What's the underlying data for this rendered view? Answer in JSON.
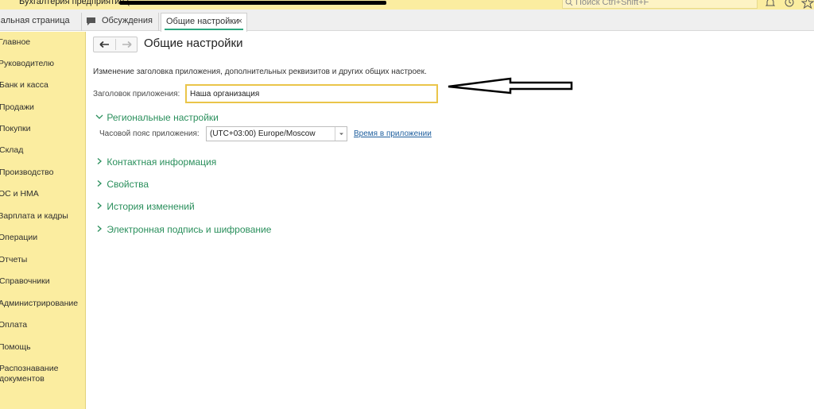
{
  "titlebar": {
    "app_title": "Бухгалтерия предприятия (",
    "search_placeholder": "Поиск Ctrl+Shift+F"
  },
  "tabs": [
    {
      "label": "чальная страница"
    },
    {
      "label": "Обсуждения"
    },
    {
      "label": "Общие настройки",
      "close": "×"
    }
  ],
  "sidebar": {
    "items": [
      {
        "label": "Главное"
      },
      {
        "label": "Руководителю"
      },
      {
        "label": "Банк и касса"
      },
      {
        "label": "Продажи"
      },
      {
        "label": "Покупки"
      },
      {
        "label": "Склад"
      },
      {
        "label": "Производство"
      },
      {
        "label": "ОС и НМА"
      },
      {
        "label": "Зарплата и кадры"
      },
      {
        "label": "Операции"
      },
      {
        "label": "Отчеты"
      },
      {
        "label": "Справочники"
      },
      {
        "label": "Администрирование"
      },
      {
        "label": "Оплата"
      },
      {
        "label": "Помощь"
      },
      {
        "label": "Распознавание документов"
      }
    ]
  },
  "main": {
    "title": "Общие настройки",
    "description": "Изменение заголовка приложения, дополнительных реквизитов и других общих настроек.",
    "app_title_label": "Заголовок приложения:",
    "app_title_value": "Наша организация",
    "sections": [
      {
        "label": "Региональные настройки",
        "expanded": true
      },
      {
        "label": "Контактная информация",
        "expanded": false
      },
      {
        "label": "Свойства",
        "expanded": false
      },
      {
        "label": "История изменений",
        "expanded": false
      },
      {
        "label": "Электронная подпись и шифрование",
        "expanded": false
      }
    ],
    "timezone_label": "Часовой пояс приложения:",
    "timezone_value": "(UTC+03:00) Europe/Moscow",
    "timezone_link": "Время в приложении"
  },
  "colors": {
    "sidebar_bg": "#fbeda0",
    "accent_green": "#2a8f5c",
    "link_blue": "#1f5f9e",
    "input_focus": "#eac54a"
  }
}
